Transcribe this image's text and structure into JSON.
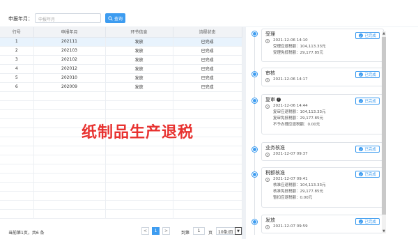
{
  "filter": {
    "label": "申报年月：",
    "placeholder": "申报年月",
    "query_label": "查询"
  },
  "table": {
    "headers": [
      "行号",
      "申报年月",
      "环节信息",
      "流程状态"
    ],
    "rows": [
      [
        "1",
        "202111",
        "发放",
        "已完成"
      ],
      [
        "2",
        "202103",
        "发放",
        "已完成"
      ],
      [
        "3",
        "202102",
        "发放",
        "已完成"
      ],
      [
        "4",
        "202012",
        "发放",
        "已完成"
      ],
      [
        "5",
        "202010",
        "发放",
        "已完成"
      ],
      [
        "6",
        "202009",
        "发放",
        "已完成"
      ]
    ],
    "selected_row": 1
  },
  "pager": {
    "info": "当前第1页，共6 条",
    "prev": "<",
    "current_page": "1",
    "next": ">",
    "goto_label": "到第",
    "goto_value": "1",
    "page_unit": "页",
    "page_size": "10条/页",
    "caret": "▼"
  },
  "watermark": "纸制品生产退税",
  "timeline": {
    "badge_label": "已完成",
    "cards": [
      {
        "title": "受理",
        "time": "2021-12-06 14:10",
        "lines": [
          "受理应退税额：104,113.33元",
          "受理免抵税额：29,177.85元"
        ],
        "badge": true
      },
      {
        "title": "审核",
        "time": "2021-12-06 14:17",
        "lines": [],
        "badge": true
      },
      {
        "title": "复审",
        "time": "2021-12-06 14:44",
        "lines": [
          "复审应退税额：104,113.33元",
          "复审免抵税额：29,177.85元",
          "不予办理应退税额：0.00元"
        ],
        "badge": true,
        "help": "?"
      },
      {
        "title": "业务核准",
        "time": "2021-12-07 09:37",
        "lines": [],
        "badge": true
      },
      {
        "title": "税额核准",
        "time": "2021-12-07 09:41",
        "lines": [
          "核准应退税额：104,113.33元",
          "核准免抵税额：29,177.85元",
          "暂扣应退税额：0.00元"
        ],
        "badge": true
      },
      {
        "title": "发放",
        "time": "2021-12-07 09:59",
        "lines": [],
        "badge": true
      }
    ]
  },
  "colors": {
    "accent": "#3d9cf0",
    "watermark": "#e8312f",
    "selected_row": "#e8f3fd"
  }
}
